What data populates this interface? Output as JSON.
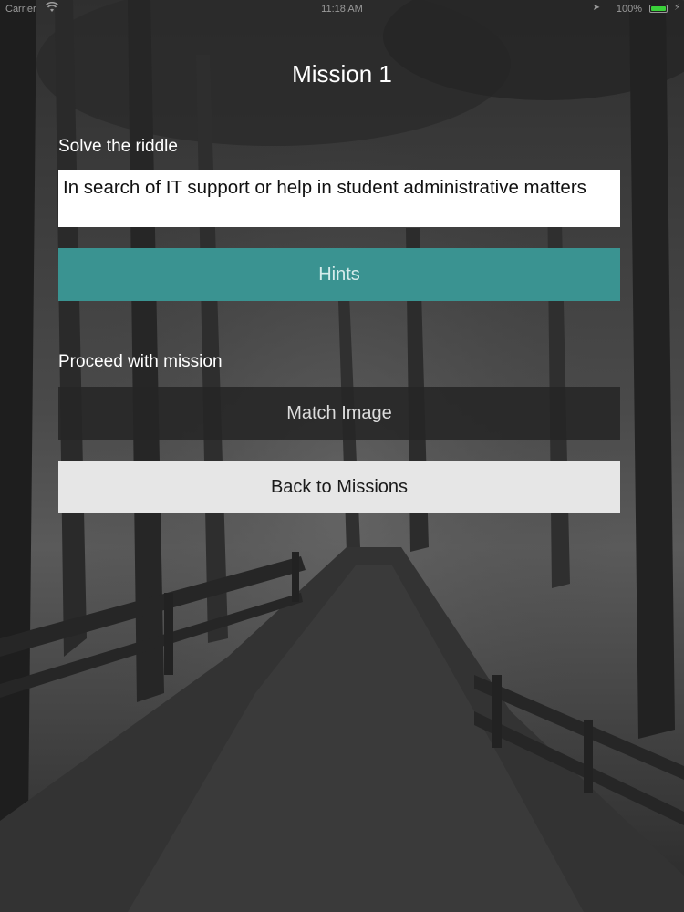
{
  "status_bar": {
    "carrier": "Carrier",
    "wifi_icon": "wifi-icon",
    "time": "11:18 AM",
    "location_icon": "location-arrow-icon",
    "battery_percent": "100%",
    "battery_icon": "battery-icon",
    "charging_icon": "charging-bolt-icon"
  },
  "page": {
    "title": "Mission 1"
  },
  "riddle": {
    "label": "Solve the riddle",
    "text": "In search of IT support or help in student administrative matters"
  },
  "buttons": {
    "hints": "Hints",
    "proceed_label": "Proceed with mission",
    "match_image": "Match Image",
    "back": "Back to Missions"
  },
  "colors": {
    "hints_button": "#3a9391",
    "match_button": "#262626",
    "back_button": "#e6e6e6",
    "battery_fill": "#3ad13a"
  }
}
